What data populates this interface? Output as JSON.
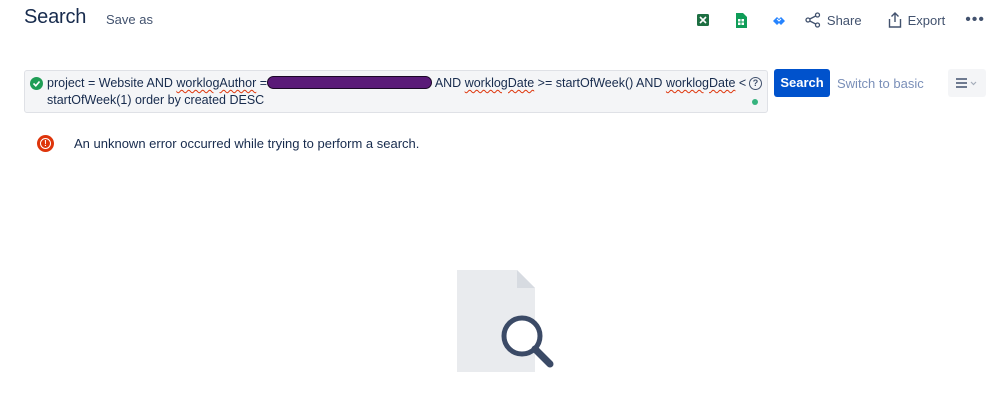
{
  "header": {
    "title": "Search",
    "save_as_label": "Save as"
  },
  "toolbar": {
    "excel_icon": "excel-icon",
    "sheets_icon": "google-sheets-icon",
    "cloud_icon": "cloud-sync-icon",
    "share_label": "Share",
    "export_label": "Export",
    "more_label": "•••"
  },
  "query": {
    "valid_icon": "check-circle-icon",
    "part1": "project = Website AND ",
    "field1": "worklogAuthor",
    "part2": " =",
    "part3": " AND ",
    "field2": "worklogDate",
    "part4": " >= startOfWeek() AND ",
    "field3": "worklogDate",
    "part5": " < startOfWeek(1) order by created DESC",
    "help_label": "?"
  },
  "actions": {
    "search_label": "Search",
    "switch_label": "Switch to basic"
  },
  "error": {
    "message": "An unknown error occurred while trying to perform a search.",
    "icon_label": "!"
  },
  "colors": {
    "primary": "#0052cc",
    "error": "#de350b",
    "success": "#36b37e"
  }
}
